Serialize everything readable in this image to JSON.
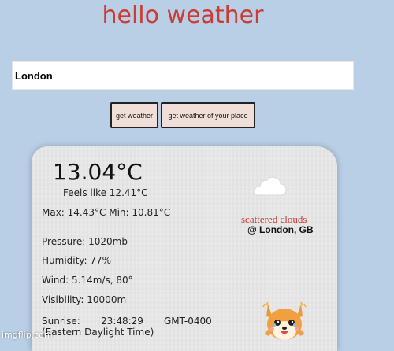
{
  "header": {
    "title": "hello weather"
  },
  "search": {
    "value": "London"
  },
  "buttons": {
    "get_weather": "get weather",
    "get_weather_place": "get weather of your place"
  },
  "weather": {
    "temperature": "13.04°C",
    "feels_like": "Feels like 12.41°C",
    "min_max": "Max: 14.43°C Min: 10.81°C",
    "pressure": "Pressure: 1020mb",
    "humidity": "Humidity: 77%",
    "wind": "Wind: 5.14m/s, 80°",
    "visibility": "Visibility: 10000m",
    "sunrise_label": "Sunrise:",
    "sunrise_time": "23:48:29",
    "sunrise_gmt": "GMT-0400",
    "timezone_name": "(Eastern Daylight Time)",
    "description": "scattered clouds",
    "location": "@ London, GB",
    "condition_icon": "cloud-icon"
  },
  "mascot": {
    "icon": "shiba-dog-icon"
  },
  "watermark": {
    "text": "imgflip.com"
  },
  "colors": {
    "background": "#b8cfe6",
    "title": "#cc3b34",
    "description": "#c0392b",
    "button_bg": "#f0dfd8",
    "card_bg": "#e9e9e9"
  }
}
